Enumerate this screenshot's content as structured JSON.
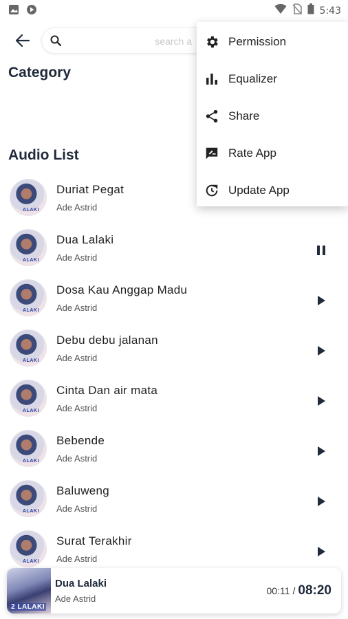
{
  "status_bar": {
    "time": "5:43",
    "left_icons": [
      "image-icon",
      "play-circle-icon"
    ],
    "right_icons": [
      "wifi-icon",
      "no-sim-icon",
      "battery-icon"
    ]
  },
  "search": {
    "placeholder": "search a"
  },
  "sections": {
    "category_title": "Category",
    "audio_list_title": "Audio List"
  },
  "audio_list": [
    {
      "title": "Duriat Pegat",
      "artist": "Ade Astrid",
      "state": "none"
    },
    {
      "title": "Dua Lalaki",
      "artist": "Ade Astrid",
      "state": "pause"
    },
    {
      "title": "Dosa Kau Anggap Madu",
      "artist": "Ade Astrid",
      "state": "play"
    },
    {
      "title": "Debu debu jalanan",
      "artist": "Ade Astrid",
      "state": "play"
    },
    {
      "title": "Cinta Dan air mata",
      "artist": "Ade Astrid",
      "state": "play"
    },
    {
      "title": "Bebende",
      "artist": "Ade Astrid",
      "state": "play"
    },
    {
      "title": "Baluweng",
      "artist": "Ade Astrid",
      "state": "play"
    },
    {
      "title": "Surat Terakhir",
      "artist": "Ade Astrid",
      "state": "play"
    }
  ],
  "cover_tag": "ALAKI",
  "mini_player": {
    "title": "Dua Lalaki",
    "artist": "Ade Astrid",
    "current_time": "00:11",
    "separator": "/",
    "duration": "08:20",
    "art_tag": "2 LALAKI"
  },
  "menu": [
    {
      "label": "Permission",
      "icon": "gear-icon"
    },
    {
      "label": "Equalizer",
      "icon": "equalizer-icon"
    },
    {
      "label": "Share",
      "icon": "share-icon"
    },
    {
      "label": "Rate App",
      "icon": "rate-icon"
    },
    {
      "label": "Update App",
      "icon": "update-icon"
    }
  ],
  "colors": {
    "primary_text": "#1f2a3a",
    "caret": "#e53b6a"
  }
}
